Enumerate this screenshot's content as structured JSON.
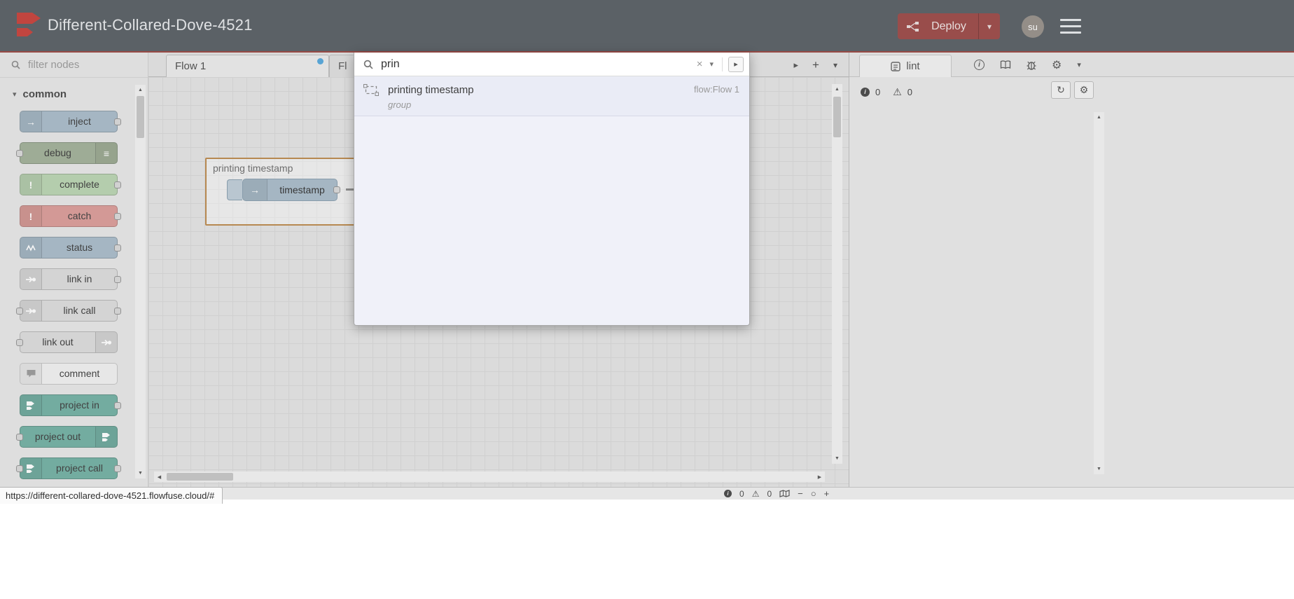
{
  "icons": {
    "caret_down": "▾",
    "caret_right": "▸",
    "close": "×",
    "add": "+",
    "gear": "⚙",
    "refresh": "↻",
    "warning": "⚠",
    "info_letter": "i",
    "inject_arrow": "→",
    "debug_lines": "≡",
    "exclamation": "!",
    "zoom_out": "−",
    "zoom_reset": "○",
    "zoom_in": "+",
    "scroll_up": "▲",
    "scroll_down": "▼",
    "scroll_left": "◀",
    "scroll_right": "▶"
  },
  "header": {
    "title": "Different-Collared-Dove-4521",
    "deploy_label": "Deploy",
    "avatar_text": "su"
  },
  "palette": {
    "filter_placeholder": "filter nodes",
    "category_label": "common",
    "items": [
      {
        "label": "inject",
        "color": "#a9bcca"
      },
      {
        "label": "debug",
        "color": "#a2b199"
      },
      {
        "label": "complete",
        "color": "#bad4b2"
      },
      {
        "label": "catch",
        "color": "#db9d99"
      },
      {
        "label": "status",
        "color": "#a9bcca"
      },
      {
        "label": "link in",
        "color": "#dcdcdc"
      },
      {
        "label": "link call",
        "color": "#dcdcdc"
      },
      {
        "label": "link out",
        "color": "#dcdcdc"
      },
      {
        "label": "comment",
        "color": "#f0f0f0"
      },
      {
        "label": "project in",
        "color": "#74b1a4"
      },
      {
        "label": "project out",
        "color": "#74b1a4"
      },
      {
        "label": "project call",
        "color": "#74b1a4"
      }
    ]
  },
  "workspace": {
    "tabs": [
      {
        "label": "Flow 1"
      },
      {
        "label": "Fl"
      }
    ],
    "group_label": "printing timestamp",
    "node_label": "timestamp",
    "footer": {
      "info_count": "0",
      "warning_count": "0"
    }
  },
  "search": {
    "query": "prin",
    "results": [
      {
        "title": "printing timestamp",
        "subtitle": "group",
        "location": "flow:Flow 1"
      }
    ]
  },
  "sidebar": {
    "tab_label": "lint",
    "info_count": "0",
    "warning_count": "0"
  },
  "statusbar": {
    "url": "https://different-collared-dove-4521.flowfuse.cloud/#"
  },
  "colors": {
    "header_bg": "#5a6066",
    "accent_red": "#9a4742",
    "deploy_bg": "#9d4b49",
    "unsaved_dot": "#57a8dc",
    "group_border": "#bd8b4f"
  }
}
